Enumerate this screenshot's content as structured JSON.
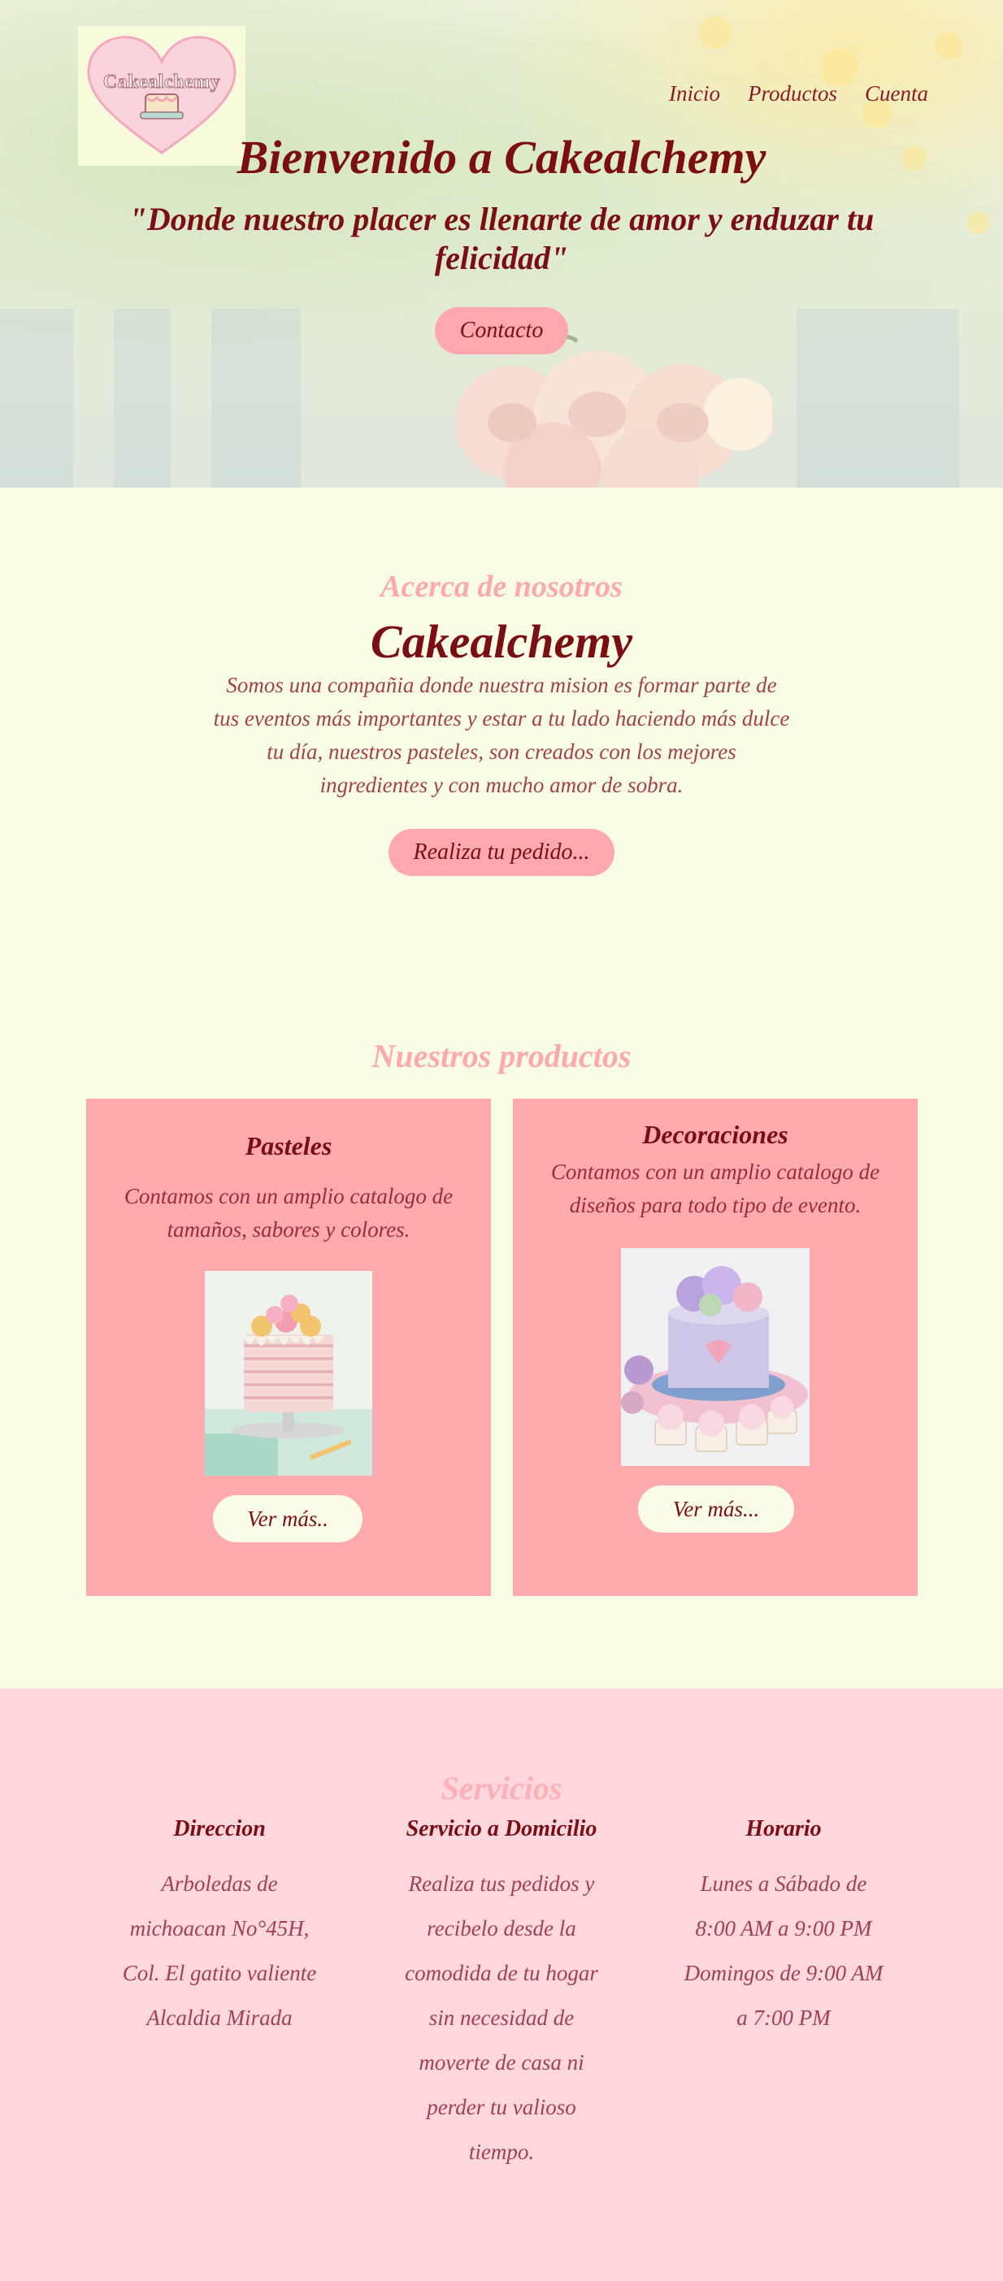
{
  "brand": {
    "logo_text": "Cakealchemy"
  },
  "nav": {
    "items": [
      "Inicio",
      "Productos",
      "Cuenta"
    ]
  },
  "hero": {
    "title": "Bienvenido a Cakealchemy",
    "subtitle": "\"Donde nuestro placer es llenarte de amor y enduzar tu felicidad\"",
    "contact_button": "Contacto"
  },
  "about": {
    "kicker": "Acerca de nosotros",
    "title": "Cakealchemy",
    "text": "Somos una compañia donde nuestra mision es formar parte de tus eventos más importantes y estar a tu lado haciendo más dulce tu día, nuestros pasteles, son creados con los mejores ingredientes y con mucho amor de sobra.",
    "order_button": "Realiza tu pedido..."
  },
  "products": {
    "title": "Nuestros productos",
    "cards": [
      {
        "title": "Pasteles",
        "text": "Contamos con un amplio catalogo de tamaños, sabores y colores.",
        "button": "Ver más.."
      },
      {
        "title": "Decoraciones",
        "text": "Contamos con un amplio catalogo de diseños para todo tipo de evento.",
        "button": "Ver más..."
      }
    ]
  },
  "services": {
    "title": "Servicios",
    "columns": [
      {
        "title": "Direccion",
        "lines": [
          "Arboledas de",
          "michoacan No°45H,",
          "Col. El gatito valiente",
          "Alcaldia Mirada"
        ]
      },
      {
        "title": "Servicio a Domicilio",
        "lines": [
          "Realiza tus pedidos y",
          "recibelo desde la",
          "comodida de tu hogar",
          "sin necesidad de",
          "moverte de casa ni",
          "perder tu valioso",
          "tiempo."
        ]
      },
      {
        "title": "Horario",
        "lines": [
          "Lunes a Sábado de",
          "8:00 AM a 9:00 PM",
          "Domingos de 9:00 AM",
          "a 7:00 PM"
        ]
      }
    ]
  },
  "colors": {
    "background": "#f9fde4",
    "primary_text": "#7b0d14",
    "accent_pink": "#ffa9ae",
    "services_bg": "#ffd7dc"
  }
}
